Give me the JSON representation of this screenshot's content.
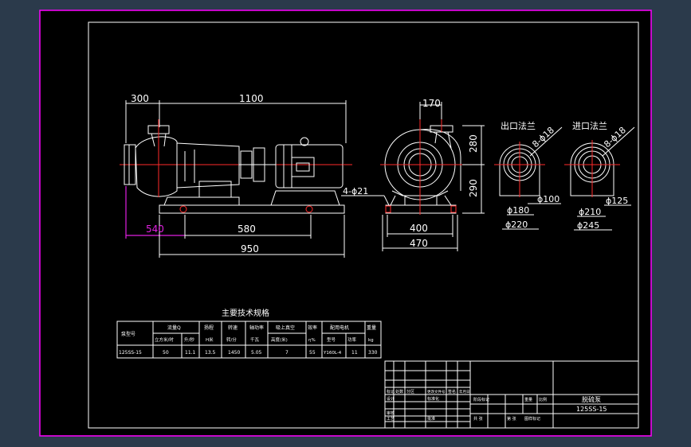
{
  "colors": {
    "viewport_bg": "#2b3a4b",
    "sheet_bg": "#000000",
    "frame": "#ff00ff",
    "line": "#ffffff",
    "center_line": "#ff2a2a",
    "highlight_dim": "#e020e0"
  },
  "side_view": {
    "dims": {
      "d300": "300",
      "d1100": "1100",
      "d540": "540",
      "d580": "580",
      "d950": "950"
    }
  },
  "front_view": {
    "dims": {
      "d170": "170",
      "d280": "280",
      "d290": "290",
      "d400": "400",
      "d470": "470",
      "bolt": "4-ϕ21"
    }
  },
  "outlet_flange": {
    "title": "出口法兰",
    "holes": "8-ϕ18",
    "d_in": "ϕ100",
    "d_mid": "ϕ180",
    "d_out": "ϕ220"
  },
  "inlet_flange": {
    "title": "进口法兰",
    "holes": "8-ϕ18",
    "d_in": "ϕ125",
    "d_mid": "ϕ210",
    "d_out": "ϕ245"
  },
  "spec_table": {
    "title": "主要技术规格",
    "headers": [
      "泵型号",
      "流量Q",
      "扬程",
      "转速",
      "轴功率",
      "吸上真空",
      "效率",
      "配用电机",
      "重量"
    ],
    "subheaders": [
      "",
      "立方米/时",
      "升/秒",
      "H米",
      "转/分",
      "千瓦",
      "高度(米)",
      "η%",
      "型号",
      "功率",
      "kg"
    ],
    "row": [
      "125SS-15",
      "50",
      "11.1",
      "13.5",
      "1450",
      "5.05",
      "7",
      "55",
      "Y160L-4",
      "11",
      "330"
    ]
  },
  "title_block": {
    "drawing_name": "脱硫泵",
    "drawing_code": "125SS-15",
    "small_labels": [
      "标记",
      "处数",
      "分区",
      "更改文件号",
      "签名",
      "年月日",
      "设计",
      "标准化",
      "阶段标记",
      "重量",
      "比例",
      "审核",
      "工艺",
      "批准",
      "共 张",
      "第 张",
      "图样标记"
    ]
  }
}
